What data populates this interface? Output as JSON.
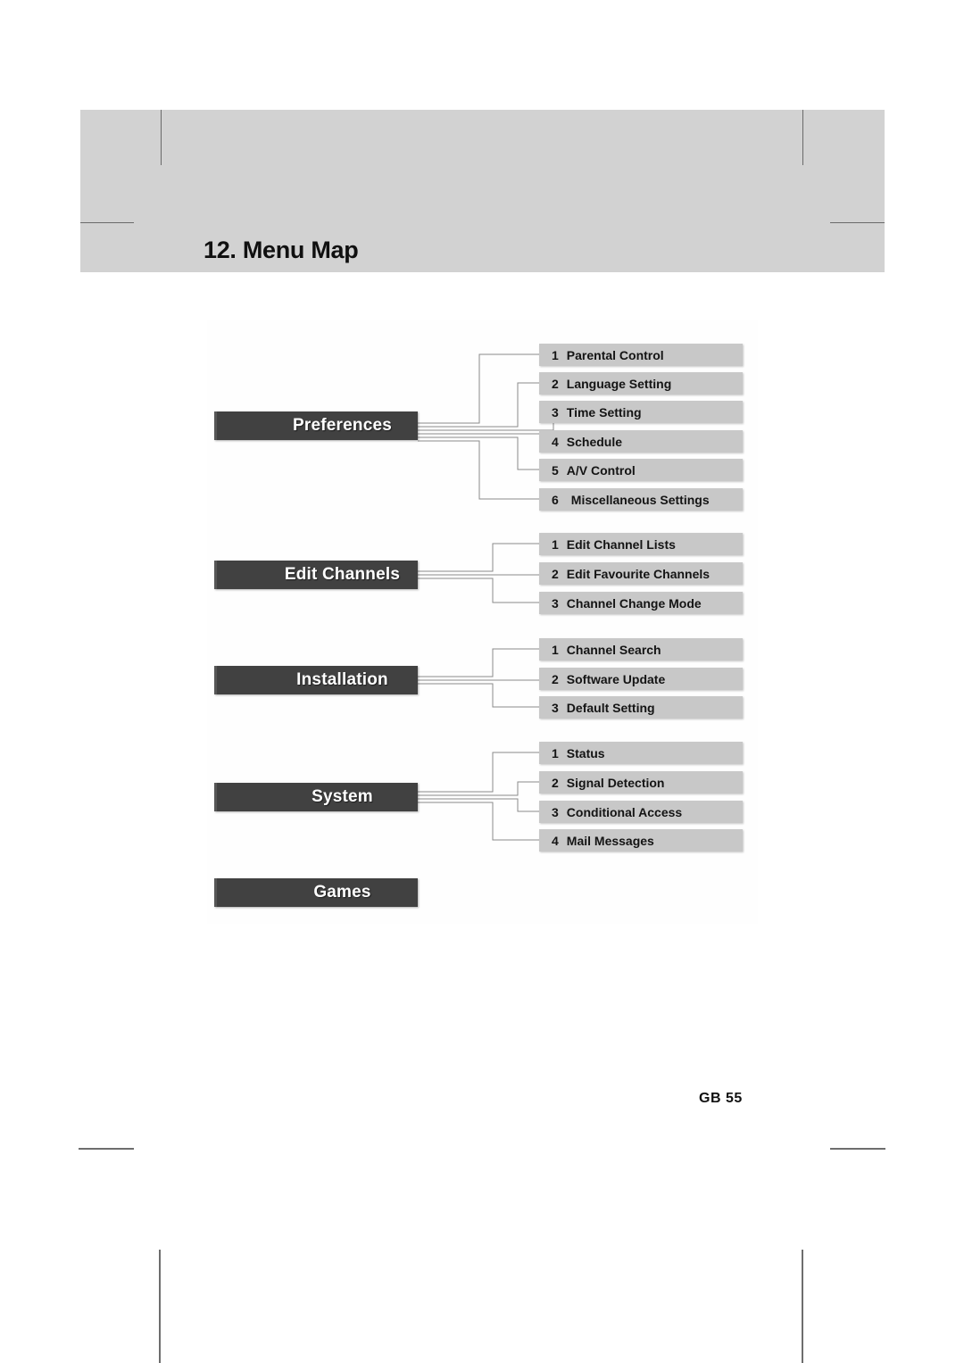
{
  "page": {
    "title": "12. Menu Map",
    "footer_page_label": "GB 55"
  },
  "colors": {
    "header_band": "#d2d2d2",
    "main_node": "#414141",
    "sub_node": "#c8c8c8",
    "main_node_text": "#ffffff",
    "sub_node_text": "#141414",
    "connector_line": "#8a8a8a"
  },
  "menu_map": {
    "groups": [
      {
        "name": "Preferences",
        "items": [
          {
            "index": "1",
            "label": "Parental Control"
          },
          {
            "index": "2",
            "label": "Language Setting"
          },
          {
            "index": "3",
            "label": "Time Setting"
          },
          {
            "index": "4",
            "label": "Schedule"
          },
          {
            "index": "5",
            "label": "A/V Control"
          },
          {
            "index": "6",
            "label": "Miscellaneous Settings"
          }
        ]
      },
      {
        "name": "Edit Channels",
        "items": [
          {
            "index": "1",
            "label": "Edit Channel Lists"
          },
          {
            "index": "2",
            "label": "Edit Favourite Channels"
          },
          {
            "index": "3",
            "label": "Channel Change Mode"
          }
        ]
      },
      {
        "name": "Installation",
        "items": [
          {
            "index": "1",
            "label": "Channel Search"
          },
          {
            "index": "2",
            "label": "Software Update"
          },
          {
            "index": "3",
            "label": "Default Setting"
          }
        ]
      },
      {
        "name": "System",
        "items": [
          {
            "index": "1",
            "label": "Status"
          },
          {
            "index": "2",
            "label": "Signal Detection"
          },
          {
            "index": "3",
            "label": "Conditional Access"
          },
          {
            "index": "4",
            "label": "Mail Messages"
          }
        ]
      },
      {
        "name": "Games",
        "items": []
      }
    ]
  }
}
